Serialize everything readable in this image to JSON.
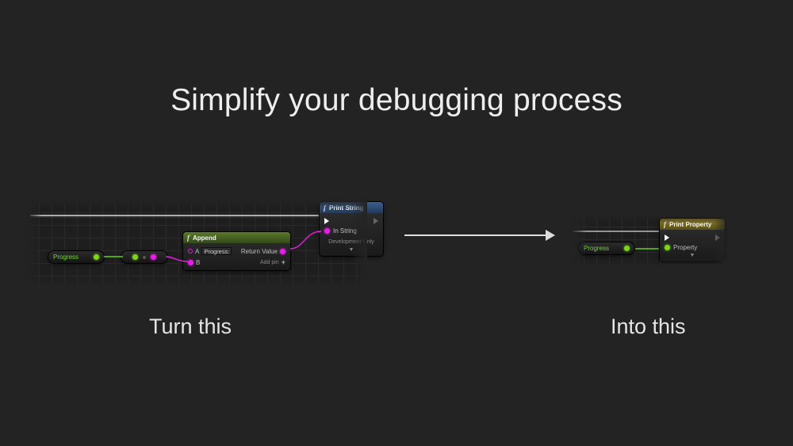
{
  "headline": "Simplify your debugging process",
  "captions": {
    "left": "Turn this",
    "right": "Into this"
  },
  "left_graph": {
    "progress_var": "Progress",
    "append_node": {
      "title": "Append",
      "pin_a": "A",
      "pin_a_default": "Progress:",
      "pin_b": "B",
      "out_label": "Return Value",
      "add_pin": "Add pin"
    },
    "print_node": {
      "title": "Print String",
      "in_string": "In String",
      "dev_only": "Development Only"
    }
  },
  "right_graph": {
    "progress_var": "Progress",
    "print_property_node": {
      "title": "Print Property",
      "property_pin": "Property"
    }
  }
}
